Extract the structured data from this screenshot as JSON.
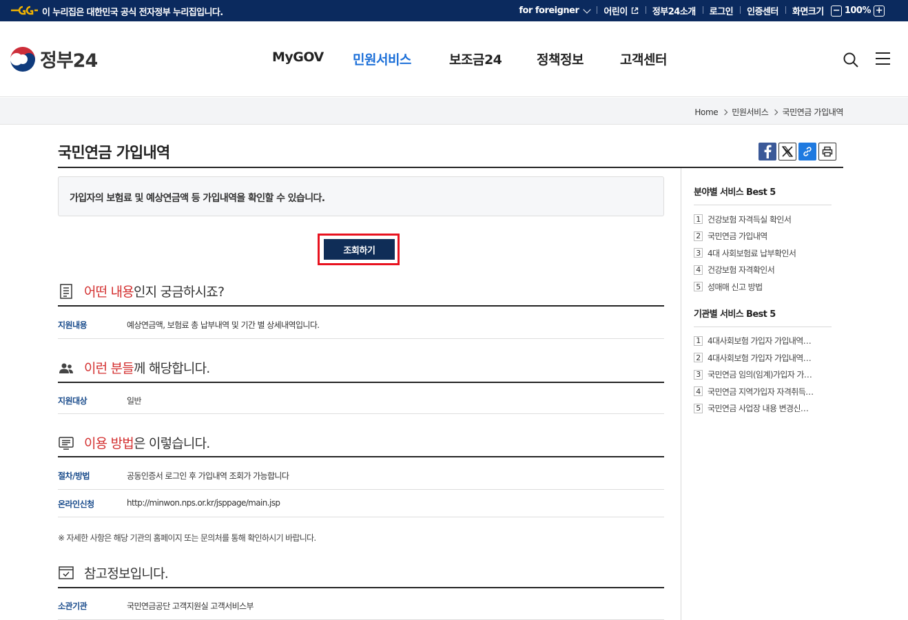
{
  "topbar": {
    "gov_notice": "이 누리집은 대한민국 공식 전자정부 누리집입니다.",
    "links": {
      "foreigner": "for foreigner",
      "kids": "어린이",
      "about": "정부24소개",
      "login": "로그인",
      "cert": "인증센터",
      "zoom_label": "화면크기",
      "zoom_minus": "−",
      "zoom_value": "100%",
      "zoom_plus": "+"
    }
  },
  "header": {
    "logo_text": "정부24",
    "nav": [
      "MyGOV",
      "민원서비스",
      "보조금24",
      "정책정보",
      "고객센터"
    ],
    "active_nav": "민원서비스"
  },
  "breadcrumb": [
    "Home",
    "민원서비스",
    "국민연금 가입내역"
  ],
  "page": {
    "title": "국민연금 가입내역",
    "intro": "가입자의 보험료 및 예상연금액 등 가입내역을 확인할 수 있습니다.",
    "lookup_button": "조회하기"
  },
  "sections": {
    "what": {
      "highlight": "어떤 내용",
      "rest": "인지 궁금하시죠?",
      "rows": [
        {
          "key": "지원내용",
          "value": "예상연금액, 보험료 총 납부내역 및 기간 별 상세내역입니다."
        }
      ]
    },
    "who": {
      "highlight": "이런 분들",
      "rest": "께 해당합니다.",
      "rows": [
        {
          "key": "지원대상",
          "value": "일반"
        }
      ]
    },
    "how": {
      "highlight": "이용 방법",
      "rest": "은 이렇습니다.",
      "rows": [
        {
          "key": "절차/방법",
          "value": "공동인증서 로그인 후 가입내역 조회가 가능합니다"
        },
        {
          "key": "온라인신청",
          "value": "http://minwon.nps.or.kr/jsppage/main.jsp"
        }
      ],
      "note": "※ 자세한 사항은 해당 기관의 홈페이지 또는 문의처를 통해 확인하시기 바랍니다."
    },
    "ref": {
      "title": "참고정보입니다.",
      "rows": [
        {
          "key": "소관기관",
          "value": "국민연금공단 고객지원실 고객서비스부"
        }
      ]
    }
  },
  "sidebar": {
    "field_title": "분야별 서비스 Best 5",
    "field_items": [
      "건강보험 자격득실 확인서",
      "국민연금 가입내역",
      "4대 사회보험료 납부확인서",
      "건강보험 자격확인서",
      "성매매 신고 방법"
    ],
    "agency_title": "기관별 서비스 Best 5",
    "agency_items": [
      "4대사회보험 가입자 가입내역…",
      "4대사회보험 가입자 가입내역…",
      "국민연금 임의(임계)가입자 가…",
      "국민연금 지역가입자 자격취득…",
      "국민연금 사업장 내용 변경신…"
    ]
  },
  "colors": {
    "topbar_bg": "#0b2a5e",
    "active_nav": "#1a6ed8",
    "highlight": "#d32f2f",
    "button_bg": "#0f2d57",
    "button_frame": "#e8121f"
  }
}
